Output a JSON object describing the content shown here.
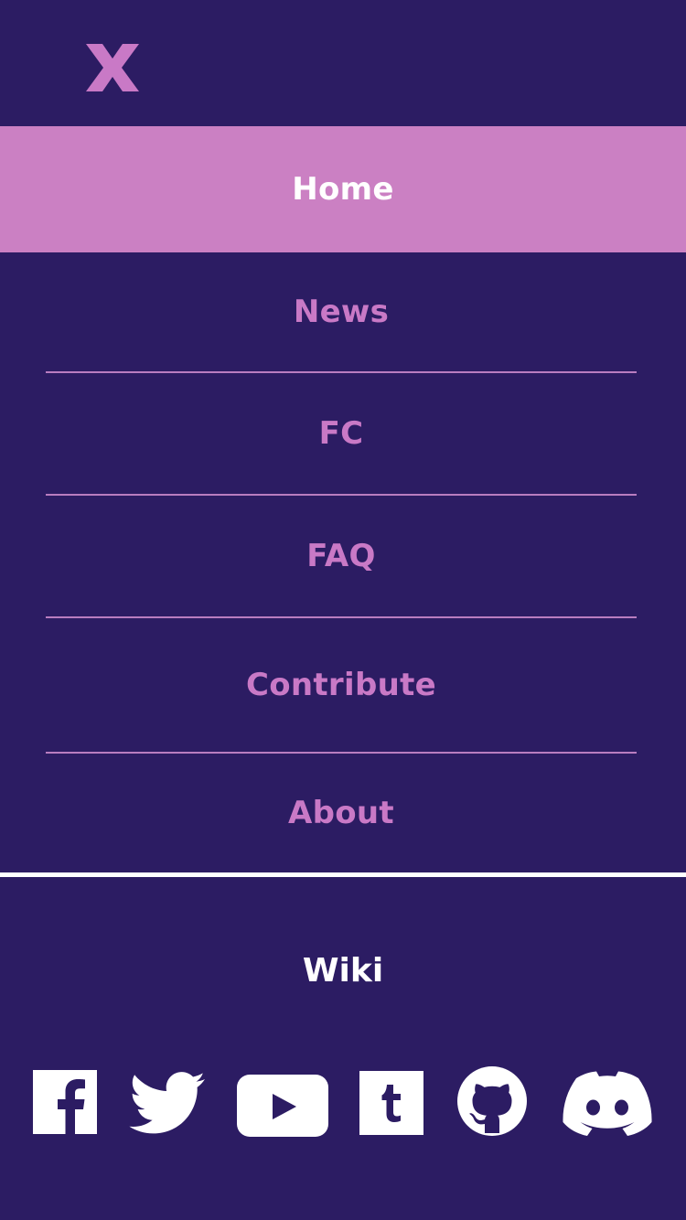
{
  "colors": {
    "background": "#2c1c63",
    "accent": "#cb80c3",
    "nav_text": "#c979c6",
    "active_text": "#ffffff",
    "divider": "#b97dc0"
  },
  "header": {
    "close_icon": "close-icon"
  },
  "nav": {
    "items": [
      {
        "label": "Home",
        "active": true
      },
      {
        "label": "News",
        "active": false
      },
      {
        "label": "FC",
        "active": false
      },
      {
        "label": "FAQ",
        "active": false
      },
      {
        "label": "Contribute",
        "active": false
      },
      {
        "label": "About",
        "active": false
      }
    ]
  },
  "footer": {
    "wiki_label": "Wiki",
    "social_icons": [
      "facebook-icon",
      "twitter-icon",
      "youtube-icon",
      "tumblr-icon",
      "github-icon",
      "discord-icon"
    ]
  }
}
